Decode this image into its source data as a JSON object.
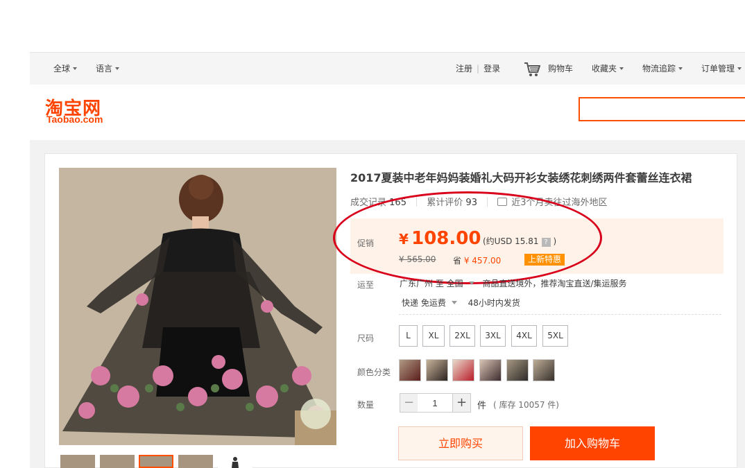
{
  "topnav": {
    "global": "全球",
    "language": "语言",
    "register": "注册",
    "login": "登录",
    "cart": "购物车",
    "favorites": "收藏夹",
    "logistics": "物流追踪",
    "orders": "订单管理"
  },
  "header": {
    "logo_cn": "淘宝网",
    "logo_en": "Taobao.com",
    "search_value": ""
  },
  "product": {
    "title": "2017夏装中老年妈妈装婚礼大码开衫女装绣花刺绣两件套蕾丝连衣裙",
    "sales_label": "成交记录",
    "sales_count": "165",
    "reviews_label": "累计评价",
    "reviews_count": "93",
    "overseas_text": "近3个月卖往过海外地区",
    "promo_label": "促销",
    "currency": "¥",
    "price": "108.00",
    "usd_prefix": "(约USD",
    "usd_value": "15.81",
    "usd_q": "?",
    "usd_suffix": ")",
    "original_price": "¥ 565.00",
    "save_prefix": "省",
    "save_amount": "¥ 457.00",
    "badge": "上新特惠",
    "shipping_label": "运至",
    "ship_from": "广东广州 至",
    "ship_to": "全国",
    "ship_service": "商品直送境外，推荐淘宝直送/集运服务",
    "ship_method": "快递 免运费",
    "ship_time": "48小时内发货",
    "size_label": "尺码",
    "sizes": [
      "L",
      "XL",
      "2XL",
      "3XL",
      "4XL",
      "5XL"
    ],
    "color_label": "颜色分类",
    "quantity_label": "数量",
    "quantity": "1",
    "minus": "−",
    "plus": "+",
    "unit": "件",
    "stock": "( 库存 10057 件)",
    "buy_now": "立即购买",
    "add_to_cart": "加入购物车"
  },
  "colors": {
    "accent": "#ff4400",
    "annotation_ring": "#d9001b"
  }
}
